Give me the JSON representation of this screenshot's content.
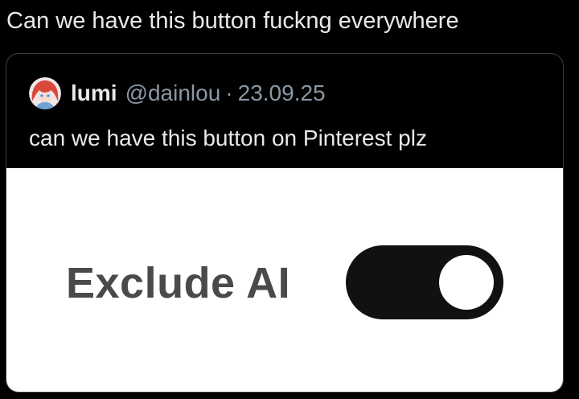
{
  "post": {
    "text": "Can we have this button fuckng everywhere"
  },
  "quote": {
    "display_name": "lumi",
    "handle": "@dainlou",
    "separator": "·",
    "date": "23.09.25",
    "text": "can we have this button on Pinterest plz",
    "avatar_icon": "anime-avatar-icon"
  },
  "media": {
    "toggle_label": "Exclude AI",
    "toggle_state": "on",
    "toggle_color": "#111111",
    "label_color": "#4a4a4a"
  }
}
